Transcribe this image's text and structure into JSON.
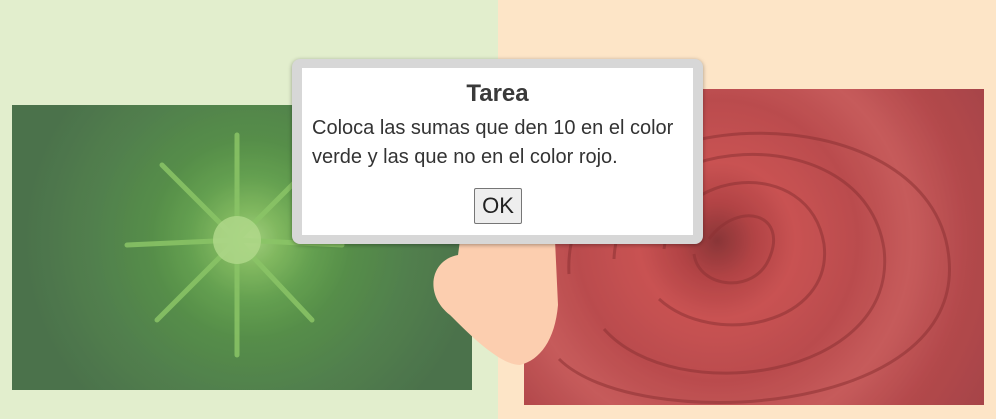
{
  "dialog": {
    "title": "Tarea",
    "message": "Coloca las sumas que den 10 en el color verde y las que no en el color rojo.",
    "ok_label": "OK"
  },
  "colors": {
    "green_panel": "#dfecc6",
    "red_panel": "#fde2c0",
    "hand": "#fcc8a4"
  },
  "images": {
    "left": "green fern plant photo",
    "right": "red rose photo",
    "center": "hand"
  }
}
